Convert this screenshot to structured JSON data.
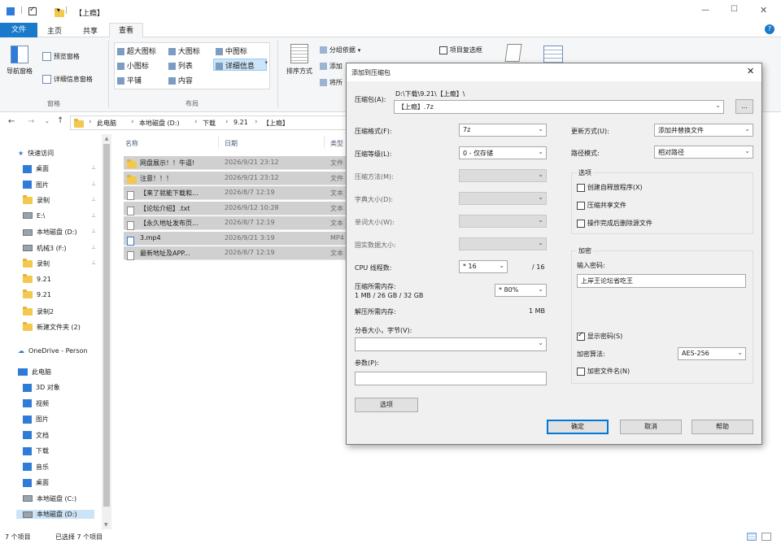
{
  "window": {
    "title": "【上瘾】",
    "controls": [
      "—",
      "☐",
      "✕"
    ]
  },
  "ribbon": {
    "tabs": [
      "文件",
      "主页",
      "共享",
      "查看"
    ],
    "active_tab": "查看",
    "panes": {
      "nav_pane": "导航窗格",
      "preview": "预览窗格",
      "details": "详细信息窗格",
      "group_label": "窗格"
    },
    "layout": {
      "items": [
        "超大图标",
        "大图标",
        "中图标",
        "小图标",
        "列表",
        "详细信息",
        "平铺",
        "内容"
      ],
      "group_label": "布局"
    },
    "sort": {
      "label": "排序方式",
      "group_by": "分组依据",
      "add": "添加",
      "resize": "将所"
    },
    "item_checkbox": "项目复选框"
  },
  "address": {
    "segments": [
      "此电脑",
      "本地磁盘 (D:)",
      "下载",
      "9.21",
      "【上瘾】"
    ]
  },
  "sidebar": {
    "quick_access": "快速访问",
    "items": [
      {
        "label": "桌面",
        "icon": "blue-folder-icon"
      },
      {
        "label": "图片",
        "icon": "blue-folder-icon"
      },
      {
        "label": "录制",
        "icon": "folder-icon"
      },
      {
        "label": "E:\\",
        "icon": "drive-icon"
      },
      {
        "label": "本地磁盘 (D:)",
        "icon": "drive-icon"
      },
      {
        "label": "机械3 (F:)",
        "icon": "drive-icon"
      },
      {
        "label": "录制",
        "icon": "folder-icon"
      },
      {
        "label": "9.21",
        "icon": "folder-icon"
      },
      {
        "label": "9.21",
        "icon": "folder-icon"
      },
      {
        "label": "录制2",
        "icon": "folder-icon"
      },
      {
        "label": "新建文件夹 (2)",
        "icon": "folder-icon"
      }
    ],
    "onedrive": "OneDrive - Person",
    "this_pc": "此电脑",
    "pc_items": [
      {
        "label": "3D 对象",
        "icon": "cube-icon"
      },
      {
        "label": "视频",
        "icon": "video-icon"
      },
      {
        "label": "图片",
        "icon": "picture-icon"
      },
      {
        "label": "文档",
        "icon": "document-icon"
      },
      {
        "label": "下载",
        "icon": "download-icon"
      },
      {
        "label": "音乐",
        "icon": "music-icon"
      },
      {
        "label": "桌面",
        "icon": "desktop-icon"
      },
      {
        "label": "本地磁盘 (C:)",
        "icon": "drive-icon"
      },
      {
        "label": "本地磁盘 (D:)",
        "icon": "drive-icon"
      }
    ]
  },
  "file_list": {
    "headers": [
      "名称",
      "日期",
      "类型"
    ],
    "rows": [
      {
        "name": "网盘展示！！牛逼!",
        "date": "2026/9/21 23:12",
        "type": "文件",
        "icon": "folder-icon"
      },
      {
        "name": "注意！！！",
        "date": "2026/9/21 23:12",
        "type": "文件",
        "icon": "folder-icon"
      },
      {
        "name": "【来了就能下载和...",
        "date": "2026/8/7 12:19",
        "type": "文本",
        "icon": "text-file-icon"
      },
      {
        "name": "【论坛介绍】.txt",
        "date": "2026/9/12 10:28",
        "type": "文本",
        "icon": "text-file-icon"
      },
      {
        "name": "【永久地址发布页...",
        "date": "2026/8/7 12:19",
        "type": "文本",
        "icon": "text-file-icon"
      },
      {
        "name": "3.mp4",
        "date": "2026/9/21 3:19",
        "type": "MP4",
        "icon": "video-file-icon"
      },
      {
        "name": "最新地址及APP...",
        "date": "2026/8/7 12:19",
        "type": "文本",
        "icon": "text-file-icon"
      }
    ]
  },
  "status_bar": {
    "count": "7 个项目",
    "selected": "已选择 7 个项目"
  },
  "dialog": {
    "title": "添加到压缩包",
    "archive_label": "压缩包(A):",
    "archive_path": "D:\\下载\\9.21\\【上瘾】\\",
    "archive_name": "【上瘾】.7z",
    "browse": "...",
    "format_label": "压缩格式(F):",
    "format_value": "7z",
    "level_label": "压缩等级(L):",
    "level_value": "0 - 仅存储",
    "method_label": "压缩方法(M):",
    "dict_label": "字典大小(D):",
    "word_label": "单词大小(W):",
    "solid_label": "固实数据大小:",
    "cpu_label": "CPU 线程数:",
    "cpu_value": "* 16",
    "cpu_total": "/ 16",
    "mem_label": "压缩所需内存:",
    "mem_detail": "1 MB / 26 GB / 32 GB",
    "mem_value": "* 80%",
    "decomp_label": "解压所需内存:",
    "decomp_value": "1 MB",
    "split_label": "分卷大小，字节(V):",
    "params_label": "参数(P):",
    "options_button": "选项",
    "update_label": "更新方式(U):",
    "update_value": "添加并替换文件",
    "path_label": "路径模式:",
    "path_value": "相对路径",
    "options_group": "选项",
    "opt_sfx": "创建自释放程序(X)",
    "opt_shared": "压缩共享文件",
    "opt_delete": "操作完成后删除源文件",
    "encrypt_group": "加密",
    "password_label": "输入密码:",
    "password_value": "上岸王论坛省吃王",
    "show_password": "显示密码(S)",
    "enc_method_label": "加密算法:",
    "enc_method_value": "AES-256",
    "encrypt_names": "加密文件名(N)",
    "ok": "确定",
    "cancel": "取消",
    "help": "帮助"
  }
}
